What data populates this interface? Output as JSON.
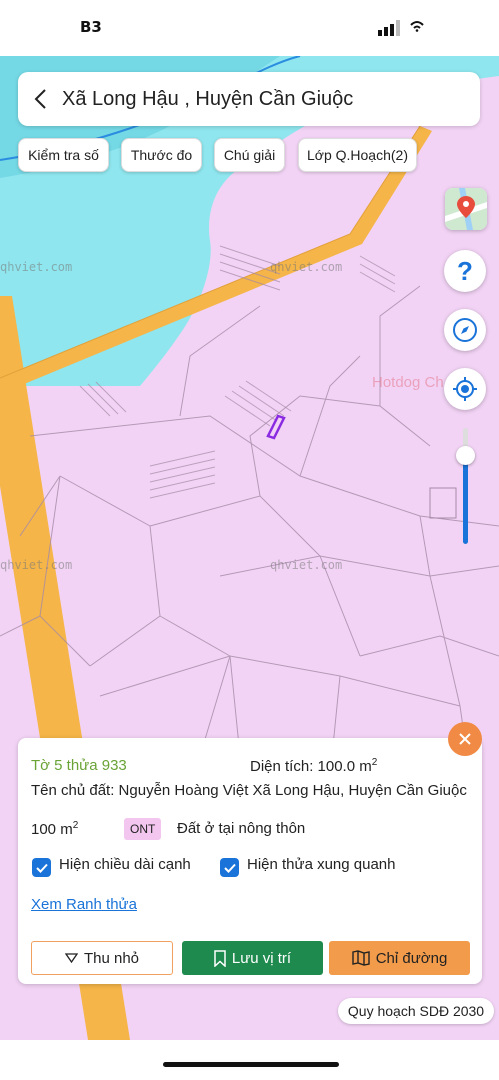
{
  "status_bar": {
    "logo": "B3"
  },
  "header": {
    "title": "Xã Long Hậu , Huyện Cần Giuộc",
    "back_icon": "chevron-left-icon"
  },
  "toolbar": {
    "chips": [
      "Kiểm tra số",
      "Thước đo",
      "Chú giải",
      "Lớp Q.Hoạch(2)"
    ]
  },
  "map": {
    "watermarks": [
      "qhviet.com",
      "qhviet.com",
      "qhviet.com",
      "qhviet.com",
      "qhviet.com"
    ],
    "poi_label": "Hotdog Ch",
    "colors": {
      "land": "#f2d3f5",
      "water": "#8fe6ee",
      "road": "#f5b548",
      "parcel_line": "#a68aa8",
      "selected_parcel": "#8a2be2"
    }
  },
  "side_controls": {
    "icons": [
      "map-layer-icon",
      "help-icon",
      "compass-icon",
      "my-location-icon"
    ],
    "help_glyph": "?",
    "zoom_level": 0.8
  },
  "parcel_panel": {
    "parcel_id": "Tờ 5 thửa 933",
    "area_label": "Diện tích: 100.0 m",
    "area_sup": "2",
    "owner": "Tên chủ đất: Nguyễn Hoàng Việt Xã Long Hậu, Huyện Cần Giuộc",
    "land_area": "100 m",
    "land_area_sup": "2",
    "land_code": "ONT",
    "land_type": "Đất ở tại nông thôn",
    "checkbox_edges": "Hiện chiều dài cạnh",
    "checkbox_neighbors": "Hiện thửa xung quanh",
    "link": "Xem Ranh thửa",
    "btn_collapse": "Thu nhỏ",
    "btn_save": "Lưu vị trí",
    "btn_directions": "Chỉ đường"
  },
  "plan_badge": "Quy hoạch SDĐ 2030"
}
